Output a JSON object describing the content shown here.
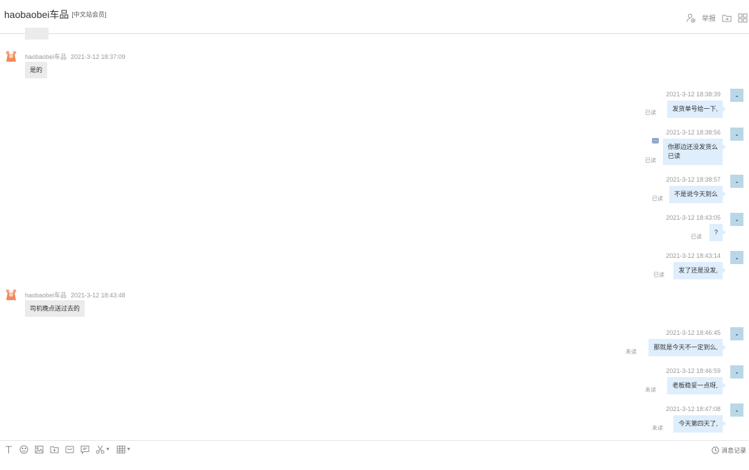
{
  "header": {
    "title": "haobaobei车品",
    "member_tag": "[中文站会员]",
    "report_label": "举报",
    "icons": [
      "add-contact-icon",
      "report-label",
      "folder-icon",
      "grid-apps-icon"
    ]
  },
  "messages": [
    {
      "side": "left",
      "sender": "haobaobei车品",
      "time": "2021-3-12 18:37:09",
      "text": "是的"
    },
    {
      "side": "right",
      "time": "2021-3-12 18:38:39",
      "text": "发货单号给一下,",
      "status": "已读"
    },
    {
      "side": "right",
      "time": "2021-3-12 18:38:56",
      "text": "你那边还没发货么\n已读",
      "status": "已读",
      "typing": "..."
    },
    {
      "side": "right",
      "time": "2021-3-12 18:38:57",
      "text": "不是说今天到么",
      "status": "已读"
    },
    {
      "side": "right",
      "time": "2021-3-12 18:43:05",
      "text": "?",
      "status": "已读"
    },
    {
      "side": "right",
      "time": "2021-3-12 18:43:14",
      "text": "发了还是没发,",
      "status": "已读"
    },
    {
      "side": "left",
      "sender": "haobaobei车品",
      "time": "2021-3-12 18:43:48",
      "text": "司机晚点送过去的"
    },
    {
      "side": "right",
      "time": "2021-3-12 18:46:45",
      "text": "那就是今天不一定到么,",
      "status": "未读"
    },
    {
      "side": "right",
      "time": "2021-3-12 18:46:59",
      "text": "老板稳妥一点呀,",
      "status": "未读"
    },
    {
      "side": "right",
      "time": "2021-3-12 18:47:08",
      "text": "今天第四天了,",
      "status": "未读"
    }
  ],
  "toolbar": {
    "tools": [
      "font-icon",
      "emoji-icon",
      "image-icon",
      "file-icon",
      "product-icon",
      "quick-reply-icon",
      "screenshot-icon",
      "table-icon"
    ],
    "history_label": "消息记录"
  },
  "colors": {
    "my_bubble": "#dfeefc",
    "their_bubble": "#ebebeb",
    "avatar_self": "#b9d7e6",
    "avatar_other": "#f08a5d"
  }
}
